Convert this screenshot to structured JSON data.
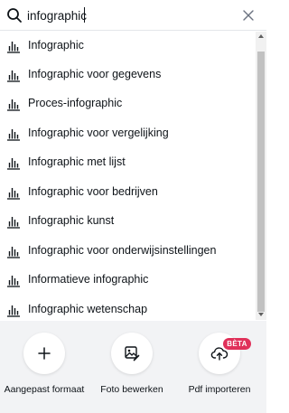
{
  "search": {
    "value": "infographic",
    "icon": "search-icon",
    "clear_icon": "close-icon"
  },
  "results": [
    {
      "label": "Infographic",
      "icon": "bar-chart-icon"
    },
    {
      "label": "Infographic voor gegevens",
      "icon": "bar-chart-icon"
    },
    {
      "label": "Proces-infographic",
      "icon": "bar-chart-icon"
    },
    {
      "label": "Infographic voor vergelijking",
      "icon": "bar-chart-icon"
    },
    {
      "label": "Infographic met lijst",
      "icon": "bar-chart-icon"
    },
    {
      "label": "Infographic voor bedrijven",
      "icon": "bar-chart-icon"
    },
    {
      "label": "Infographic kunst",
      "icon": "bar-chart-icon"
    },
    {
      "label": "Infographic voor onderwijsinstellingen",
      "icon": "bar-chart-icon"
    },
    {
      "label": "Informatieve infographic",
      "icon": "bar-chart-icon"
    },
    {
      "label": "Infographic wetenschap",
      "icon": "bar-chart-icon"
    }
  ],
  "actions": {
    "custom": {
      "label": "Aangepast formaat",
      "icon": "plus-icon"
    },
    "photo": {
      "label": "Foto bewerken",
      "icon": "image-edit-icon"
    },
    "pdf": {
      "label": "Pdf importeren",
      "icon": "cloud-upload-icon",
      "badge": "BÈTA"
    }
  },
  "colors": {
    "beta_badge": "#e0315a",
    "bottom_bar": "#f2f3f5",
    "text": "#0e1318"
  }
}
